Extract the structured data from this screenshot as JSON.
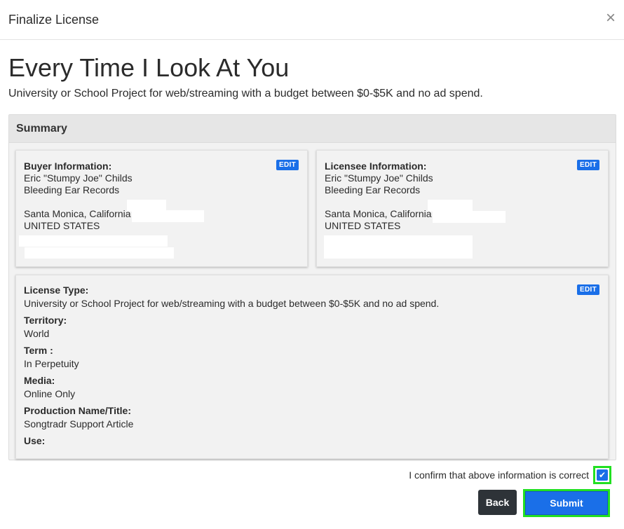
{
  "modal": {
    "title": "Finalize License",
    "close_glyph": "×"
  },
  "track": {
    "title": "Every Time I Look At You",
    "description": "University or School Project for web/streaming with a budget between $0-$5K and no ad spend."
  },
  "summary": {
    "header": "Summary",
    "edit_label": "EDIT",
    "buyer": {
      "label": "Buyer Information:",
      "name": "Eric \"Stumpy Joe\" Childs",
      "company": "Bleeding Ear Records",
      "city": "Santa Monica, California",
      "country": "UNITED STATES"
    },
    "licensee": {
      "label": "Licensee Information:",
      "name": "Eric \"Stumpy Joe\" Childs",
      "company": "Bleeding Ear Records",
      "city": "Santa Monica, California",
      "country": "UNITED STATES"
    },
    "license": {
      "type_label": "License Type:",
      "type_value": "University or School Project for web/streaming with a budget between $0-$5K and no ad spend.",
      "territory_label": "Territory:",
      "territory_value": "World",
      "term_label": "Term :",
      "term_value": "In Perpetuity",
      "media_label": "Media:",
      "media_value": "Online Only",
      "production_label": "Production Name/Title:",
      "production_value": "Songtradr Support Article",
      "use_label": "Use:"
    }
  },
  "confirm": {
    "text": "I confirm that above information is correct",
    "checked": true,
    "check_glyph": "✔"
  },
  "actions": {
    "back_label": "Back",
    "submit_label": "Submit"
  },
  "colors": {
    "accent": "#1a6fe8",
    "highlight": "#22e022",
    "back_button": "#2e3338"
  }
}
